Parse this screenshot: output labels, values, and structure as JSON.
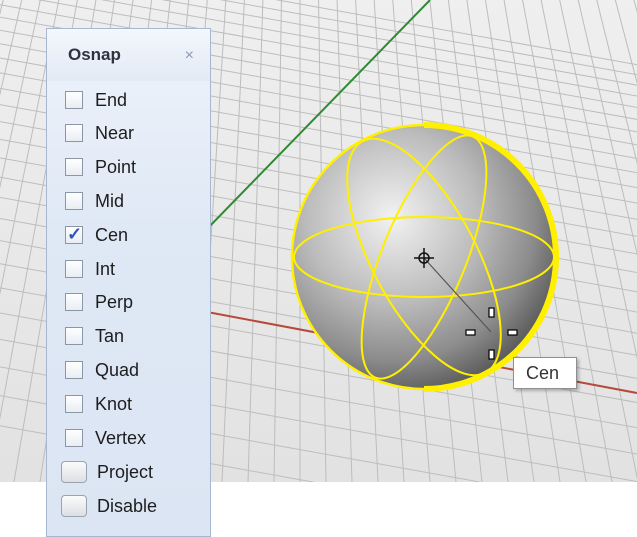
{
  "osnap_panel": {
    "title": "Osnap",
    "close_symbol": "×",
    "checkbox_items": [
      {
        "label": "End",
        "checked": false
      },
      {
        "label": "Near",
        "checked": false
      },
      {
        "label": "Point",
        "checked": false
      },
      {
        "label": "Mid",
        "checked": false
      },
      {
        "label": "Cen",
        "checked": true
      },
      {
        "label": "Int",
        "checked": false
      },
      {
        "label": "Perp",
        "checked": false
      },
      {
        "label": "Tan",
        "checked": false
      },
      {
        "label": "Quad",
        "checked": false
      },
      {
        "label": "Knot",
        "checked": false
      },
      {
        "label": "Vertex",
        "checked": false
      }
    ],
    "toggle_items": [
      {
        "label": "Project"
      },
      {
        "label": "Disable"
      }
    ]
  },
  "viewport": {
    "tooltip": "Cen",
    "colors": {
      "grid_line": "#bdbdbd",
      "x_axis": "#b64a3a",
      "y_axis": "#2f8a33",
      "selection": "#fff000",
      "background": "#ececec"
    },
    "icons": [
      "cursor-crosshair-icon",
      "grip-handle-icon"
    ]
  }
}
